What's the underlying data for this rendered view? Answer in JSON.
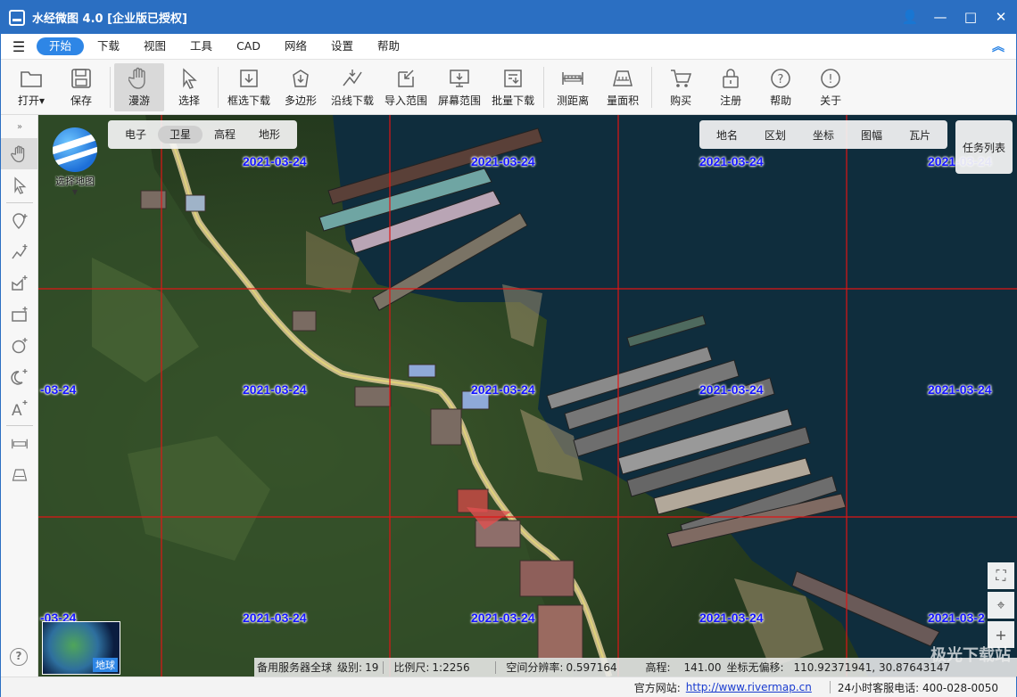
{
  "app": {
    "title": "水经微图 4.0 [企业版已授权]"
  },
  "window_buttons": {
    "user": "👤",
    "minimize": "—",
    "maximize": "□",
    "close": "✕"
  },
  "menu": {
    "items": [
      "开始",
      "下载",
      "视图",
      "工具",
      "CAD",
      "网络",
      "设置",
      "帮助"
    ],
    "active": "开始"
  },
  "toolbar": {
    "buttons": [
      {
        "label": "打开",
        "icon": "folder-icon",
        "dropdown": "▾"
      },
      {
        "label": "保存",
        "icon": "floppy-icon"
      },
      {
        "label": "漫游",
        "icon": "hand-icon",
        "active": true
      },
      {
        "label": "选择",
        "icon": "pointer-icon"
      },
      {
        "label": "框选下载",
        "icon": "rect-download-icon"
      },
      {
        "label": "多边形",
        "icon": "polygon-download-icon"
      },
      {
        "label": "沿线下载",
        "icon": "polyline-download-icon"
      },
      {
        "label": "导入范围",
        "icon": "import-icon"
      },
      {
        "label": "屏幕范围",
        "icon": "screen-icon"
      },
      {
        "label": "批量下载",
        "icon": "batch-download-icon"
      },
      {
        "label": "测距离",
        "icon": "ruler-icon"
      },
      {
        "label": "量面积",
        "icon": "area-icon"
      },
      {
        "label": "购买",
        "icon": "cart-icon"
      },
      {
        "label": "注册",
        "icon": "lock-icon"
      },
      {
        "label": "帮助",
        "icon": "help-icon"
      },
      {
        "label": "关于",
        "icon": "info-icon"
      }
    ]
  },
  "map": {
    "type_tabs": [
      "电子",
      "卫星",
      "高程",
      "地形"
    ],
    "active_type": "卫星",
    "layer_tabs": [
      "地名",
      "区划",
      "坐标",
      "图幅",
      "瓦片"
    ],
    "task_list": "任务列表",
    "select_map": "选择地图",
    "minimap_label": "地球",
    "tile_date": "2021-03-24",
    "tile_date_cut": "-03-24",
    "tile_date_right": "2021-03-2",
    "watermark": "极光下载站"
  },
  "map_status": {
    "server": "备用服务器全球",
    "level_label": "级别:",
    "level": "19",
    "scale_label": "比例尺:",
    "scale": "1:2256",
    "resolution_label": "空间分辨率:",
    "resolution": "0.597164",
    "elevation_label": "高程:",
    "elevation": "141.00",
    "coord_label": "坐标无偏移:",
    "coords": "110.92371941, 30.87643147"
  },
  "statusbar": {
    "site_label": "官方网站:",
    "site_url": "http://www.rivermap.cn",
    "phone": "24小时客服电话: 400-028-0050"
  },
  "leftbar": {
    "help": "?"
  },
  "colors": {
    "accent": "#2b6fc2",
    "active_tab": "#2e86e6",
    "grid": "#e01515",
    "date_label": "#1515ff",
    "water": "#0e2c3b"
  }
}
